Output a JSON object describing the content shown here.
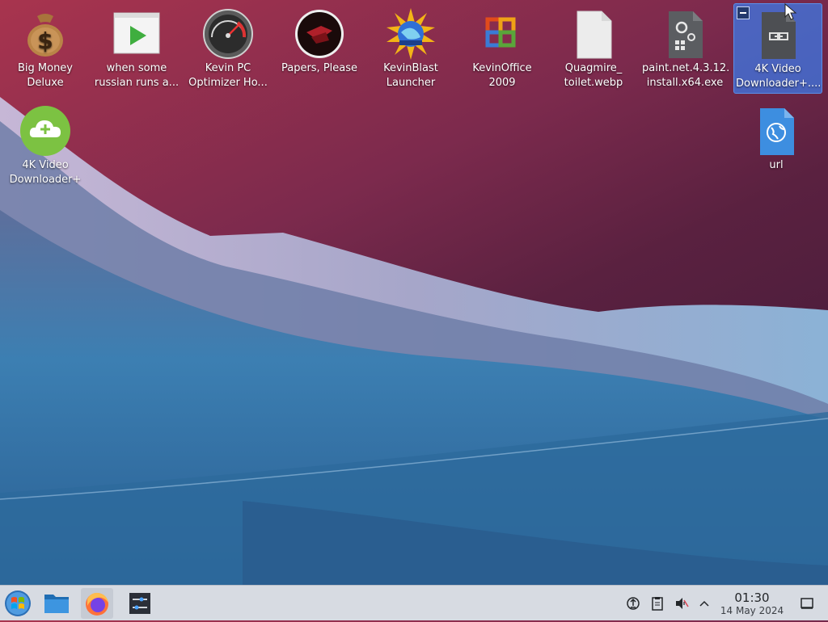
{
  "desktop": {
    "icons": [
      {
        "label": "Big Money\nDeluxe",
        "icon": "money-bag-icon"
      },
      {
        "label": "when some\nrussian runs a...",
        "icon": "video-play-icon"
      },
      {
        "label": "Kevin PC\nOptimizer Ho...",
        "icon": "speedometer-icon"
      },
      {
        "label": "Papers, Please",
        "icon": "papers-please-icon"
      },
      {
        "label": "KevinBlast\nLauncher",
        "icon": "globe-sun-icon"
      },
      {
        "label": "KevinOffice\n2009",
        "icon": "office-logo-icon"
      },
      {
        "label": "Quagmire_\ntoilet.webp",
        "icon": "blank-file-icon"
      },
      {
        "label": "paint.net.4.3.12.\ninstall.x64.exe",
        "icon": "executable-file-icon"
      },
      {
        "label": "4K Video\nDownloader+....",
        "icon": "link-file-icon",
        "selected": true
      },
      {
        "label": "4K Video\nDownloader+",
        "icon": "cloud-plus-icon"
      },
      {
        "label": "url",
        "icon": "web-link-file-icon"
      }
    ]
  },
  "taskbar": {
    "items": [
      {
        "name": "start-menu",
        "icon": "windows-logo-icon"
      },
      {
        "name": "file-manager",
        "icon": "folder-icon"
      },
      {
        "name": "firefox",
        "icon": "firefox-icon",
        "active": true
      },
      {
        "name": "settings",
        "icon": "sliders-icon"
      }
    ],
    "tray": [
      "updates-icon",
      "clipboard-icon",
      "volume-muted-icon",
      "chevron-up-icon"
    ],
    "clock": {
      "time": "01:30",
      "date": "14 May 2024"
    }
  },
  "colors": {
    "selection": "#3d78e6",
    "taskbar": "#d7dbe2",
    "accent_green": "#7cc242"
  }
}
